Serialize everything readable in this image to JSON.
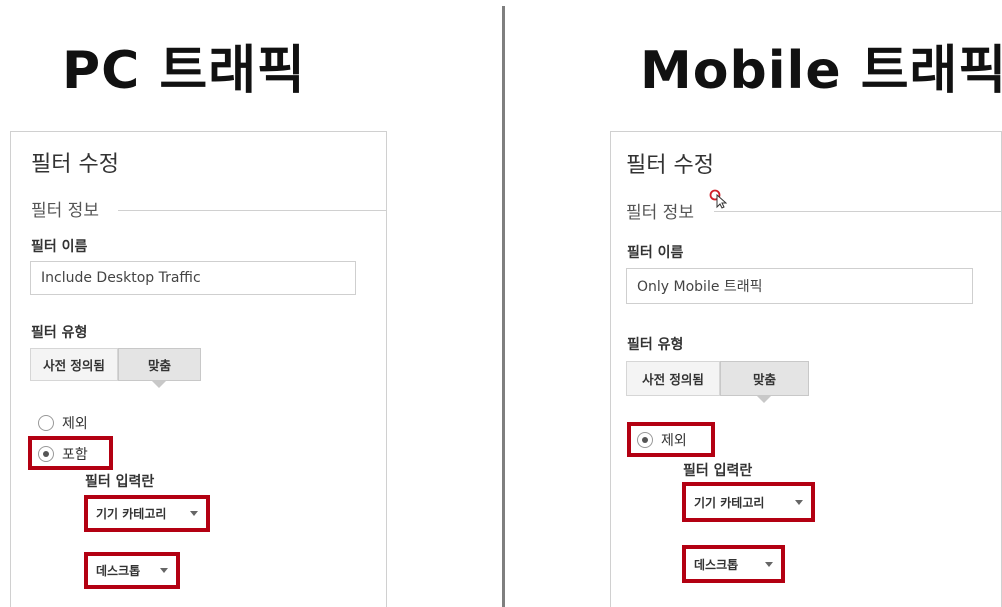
{
  "headings": {
    "pc": "PC 트래픽",
    "mobile": "Mobile 트래픽"
  },
  "left_panel": {
    "edit_title": "필터 수정",
    "section_title": "필터 정보",
    "name_label": "필터 이름",
    "name_value": "Include Desktop Traffic",
    "type_label": "필터 유형",
    "type_options": [
      "사전 정의됨",
      "맞춤"
    ],
    "type_selected": "맞춤",
    "radio_exclude": "제외",
    "radio_include": "포함",
    "radio_selected": "포함",
    "input_field_label": "필터 입력란",
    "dropdown_field": "기기 카테고리",
    "dropdown_value": "데스크톱"
  },
  "right_panel": {
    "edit_title": "필터 수정",
    "section_title": "필터 정보",
    "name_label": "필터 이름",
    "name_value": "Only Mobile 트래픽",
    "type_label": "필터 유형",
    "type_options": [
      "사전 정의됨",
      "맞춤"
    ],
    "type_selected": "맞춤",
    "radio_exclude": "제외",
    "radio_selected": "제외",
    "input_field_label": "필터 입력란",
    "dropdown_field": "기기 카테고리",
    "dropdown_value": "데스크톱"
  },
  "colors": {
    "highlight": "#b30012",
    "divider": "#7f7f7f",
    "panel_border": "#d0d0d0"
  },
  "icons": [
    "chevron-down-icon",
    "radio-icon",
    "mouse-cursor-icon"
  ]
}
